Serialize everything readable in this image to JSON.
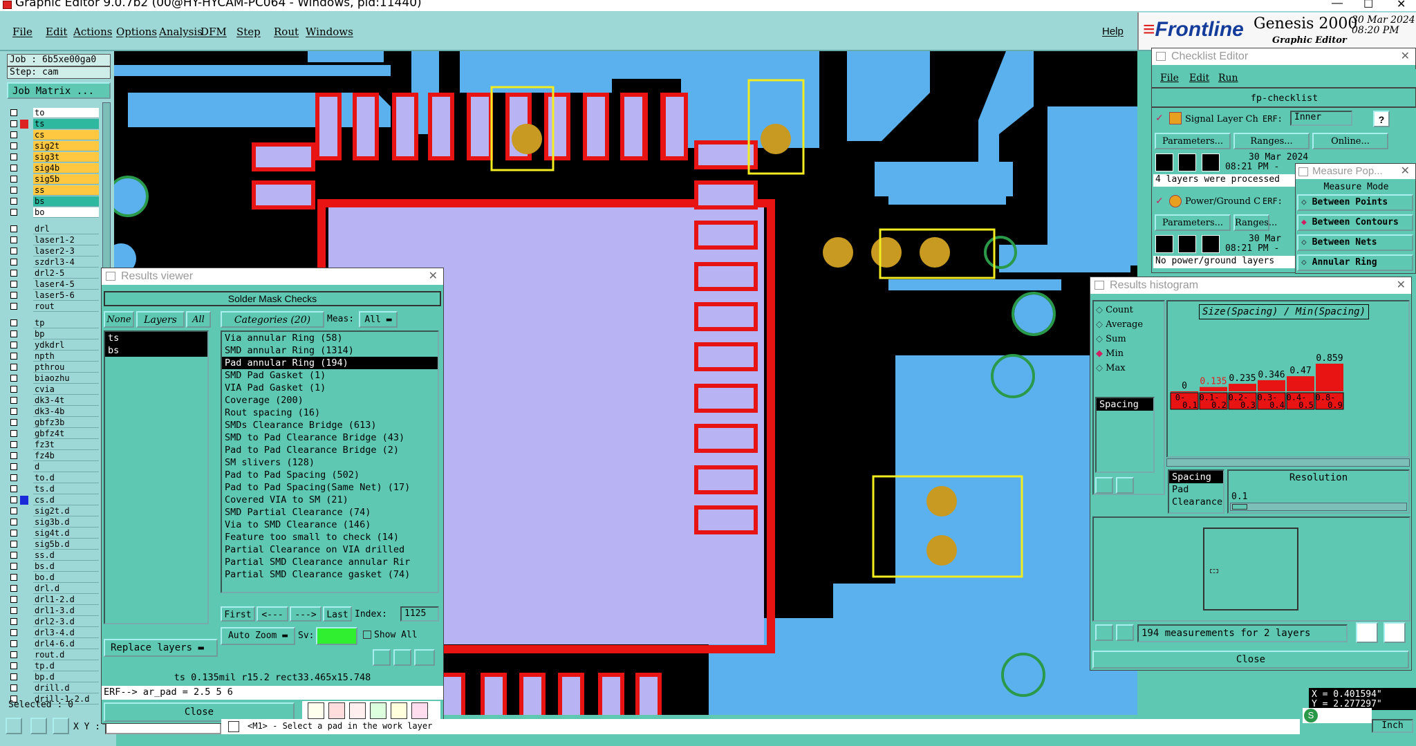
{
  "window": {
    "title": "Graphic Editor 9.0.7b2 (00@HY-HYCAM-PC064 - Windows, pid:11440)",
    "datetime": "30 Mar 2024  08:20 PM",
    "logo_text": "Frontline",
    "product": "Genesis 2000",
    "product_sub": "Graphic Editor"
  },
  "menu": [
    "File",
    "Edit",
    "Actions",
    "Options",
    "Analysis",
    "DFM",
    "Step",
    "Rout",
    "Windows"
  ],
  "help": "Help",
  "left": {
    "job": "Job : 6b5xe00ga0",
    "step": "Step: cam",
    "job_matrix": "Job Matrix ...",
    "selected": "Selected : 0",
    "xy": "X Y :"
  },
  "layers": [
    {
      "n": "to",
      "c": "#ffffff"
    },
    {
      "n": "ts",
      "c": "#2fb8a0",
      "sel": true
    },
    {
      "n": "cs",
      "c": "#ffc840"
    },
    {
      "n": "sig2t",
      "c": "#ffc840"
    },
    {
      "n": "sig3t",
      "c": "#ffc840"
    },
    {
      "n": "sig4b",
      "c": "#ffc840"
    },
    {
      "n": "sig5b",
      "c": "#ffc840"
    },
    {
      "n": "ss",
      "c": "#ffc840"
    },
    {
      "n": "bs",
      "c": "#2fb8a0"
    },
    {
      "n": "bo",
      "c": "#ffffff"
    },
    {
      "n": "drl",
      "c": "#9ed8d6"
    },
    {
      "n": "laser1-2",
      "c": "#9ed8d6"
    },
    {
      "n": "laser2-3",
      "c": "#9ed8d6"
    },
    {
      "n": "szdrl3-4",
      "c": "#9ed8d6"
    },
    {
      "n": "drl2-5",
      "c": "#9ed8d6"
    },
    {
      "n": "laser4-5",
      "c": "#9ed8d6"
    },
    {
      "n": "laser5-6",
      "c": "#9ed8d6"
    },
    {
      "n": "rout",
      "c": "#9ed8d6"
    },
    {
      "n": "tp",
      "c": "#9ed8d6"
    },
    {
      "n": "bp",
      "c": "#9ed8d6"
    },
    {
      "n": "ydkdrl",
      "c": "#9ed8d6"
    },
    {
      "n": "npth",
      "c": "#9ed8d6"
    },
    {
      "n": "pthrou",
      "c": "#9ed8d6"
    },
    {
      "n": "biaozhu",
      "c": "#9ed8d6"
    },
    {
      "n": "cvia",
      "c": "#9ed8d6"
    },
    {
      "n": "dk3-4t",
      "c": "#9ed8d6"
    },
    {
      "n": "dk3-4b",
      "c": "#9ed8d6"
    },
    {
      "n": "gbfz3b",
      "c": "#9ed8d6"
    },
    {
      "n": "gbfz4t",
      "c": "#9ed8d6"
    },
    {
      "n": "fz3t",
      "c": "#9ed8d6"
    },
    {
      "n": "fz4b",
      "c": "#9ed8d6"
    },
    {
      "n": "d",
      "c": "#9ed8d6"
    },
    {
      "n": "to.d",
      "c": "#9ed8d6"
    },
    {
      "n": "ts.d",
      "c": "#9ed8d6"
    },
    {
      "n": "cs.d",
      "c": "#9ed8d6"
    },
    {
      "n": "sig2t.d",
      "c": "#9ed8d6"
    },
    {
      "n": "sig3b.d",
      "c": "#9ed8d6"
    },
    {
      "n": "sig4t.d",
      "c": "#9ed8d6"
    },
    {
      "n": "sig5b.d",
      "c": "#9ed8d6"
    },
    {
      "n": "ss.d",
      "c": "#9ed8d6"
    },
    {
      "n": "bs.d",
      "c": "#9ed8d6"
    },
    {
      "n": "bo.d",
      "c": "#9ed8d6"
    },
    {
      "n": "drl.d",
      "c": "#9ed8d6"
    },
    {
      "n": "drl1-2.d",
      "c": "#9ed8d6"
    },
    {
      "n": "drl1-3.d",
      "c": "#9ed8d6"
    },
    {
      "n": "drl2-3.d",
      "c": "#9ed8d6"
    },
    {
      "n": "drl3-4.d",
      "c": "#9ed8d6"
    },
    {
      "n": "drl4-6.d",
      "c": "#9ed8d6"
    },
    {
      "n": "rout.d",
      "c": "#9ed8d6"
    },
    {
      "n": "tp.d",
      "c": "#9ed8d6"
    },
    {
      "n": "bp.d",
      "c": "#9ed8d6"
    },
    {
      "n": "drill.d",
      "c": "#9ed8d6"
    },
    {
      "n": "drill-1-2.d",
      "c": "#9ed8d6"
    }
  ],
  "results_viewer": {
    "title": "Results viewer",
    "header": "Solder Mask Checks",
    "btn_none": "None",
    "btn_layers": "Layers",
    "btn_all": "All",
    "categories": "Categories (20)",
    "meas": "Meas:",
    "meas_val": "All",
    "layers": [
      "ts",
      "bs"
    ],
    "items": [
      "Via annular Ring (58)",
      "SMD annular Ring (1314)",
      "Pad annular Ring (194)",
      "SMD Pad Gasket  (1)",
      "VIA Pad Gasket (1)",
      "Coverage (200)",
      "Rout spacing (16)",
      "SMDs Clearance Bridge (613)",
      "SMD to Pad Clearance Bridge (43)",
      "Pad to Pad Clearance Bridge (2)",
      "SM slivers (128)",
      "Pad to Pad Spacing (502)",
      "Pad to Pad Spacing(Same Net) (17)",
      "Covered VIA to SM (21)",
      "SMD Partial Clearance (74)",
      "Via to SMD Clearance (146)",
      "Feature too small to check (14)",
      "Partial Clearance on VIA drilled",
      "Partial SMD Clearance annular Rir",
      "Partial SMD Clearance gasket (74)"
    ],
    "first": "First",
    "prev": "<---",
    "next": "--->",
    "last": "Last",
    "index_label": "Index:",
    "index_val": "1125",
    "auto_zoom": "Auto Zoom",
    "sv": "Sv:",
    "show_all": "Show All",
    "replace": "Replace layers",
    "line1": "ts 0.135mil  r15.2  rect33.465x15.748",
    "line2": "ERF--> ar_pad = 2.5 5 6",
    "close": "Close"
  },
  "checklist": {
    "title": "Checklist Editor",
    "menu": [
      "File",
      "Edit",
      "Run"
    ],
    "name": "fp-checklist",
    "row1_name": "Signal Layer Ch",
    "erf": "ERF:",
    "row1_erf": "Inner",
    "params": "Parameters...",
    "ranges": "Ranges...",
    "online": "Online...",
    "date1": "30 Mar 2024",
    "time1": "08:21 PM -",
    "msg1": "4 layers were processed",
    "row2_name": "Power/Ground C",
    "date2": "30 Mar",
    "time2": "08:21 PM -",
    "msg2": "No power/ground layers"
  },
  "measure": {
    "title": "Measure Pop...",
    "mode": "Measure Mode",
    "opts": [
      "Between Points",
      "Between Contours",
      "Between Nets",
      "Annular Ring"
    ],
    "active": 1
  },
  "histogram": {
    "title": "Results histogram",
    "opts": [
      "Count",
      "Average",
      "Sum",
      "Min",
      "Max"
    ],
    "active": 3,
    "list": [
      "Spacing"
    ],
    "chart_title": "Size(Spacing) / Min(Spacing)",
    "bins": [
      "0-0.1",
      "0.1-0.2",
      "0.2-0.3",
      "0.3-0.4",
      "0.4-0.5",
      "0.8-0.9"
    ],
    "vals": [
      0,
      0.135,
      0.235,
      0.346,
      0.47,
      0.859
    ],
    "vlabels": [
      "0",
      "0.135",
      "0.235",
      "0.346",
      "0.47",
      "0.859"
    ],
    "list2": [
      "Spacing",
      "Pad",
      "Clearance"
    ],
    "resolution": "Resolution",
    "res_val": "0.1",
    "summary": "194 measurements for 2 layers",
    "close": "Close"
  },
  "chart_data": {
    "type": "bar",
    "title": "Size(Spacing) / Min(Spacing)",
    "categories": [
      "0-0.1",
      "0.1-0.2",
      "0.2-0.3",
      "0.3-0.4",
      "0.4-0.5",
      "0.8-0.9"
    ],
    "values": [
      0,
      0.135,
      0.235,
      0.346,
      0.47,
      0.859
    ],
    "xlabel": "",
    "ylabel": ""
  },
  "coords": {
    "x": "X = 0.401594\"",
    "y": "Y = 2.277297\"",
    "unit": "Inch"
  },
  "status": {
    "hint": "<M1> - Select a pad in the work layer"
  }
}
